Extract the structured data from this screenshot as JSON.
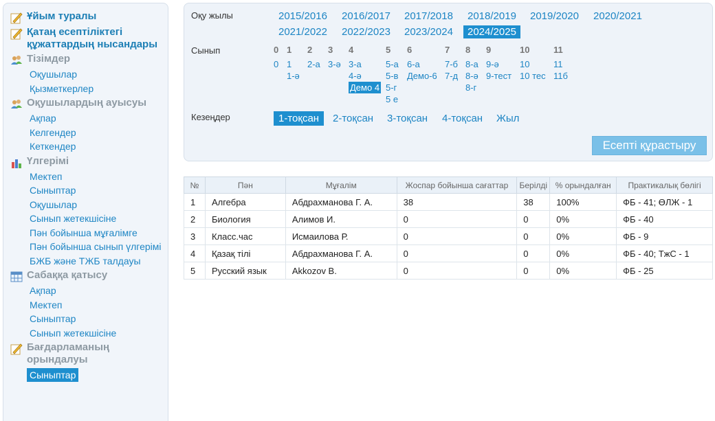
{
  "sidebar": {
    "sections": [
      {
        "title": "Ұйым туралы",
        "icon": "pencil-icon",
        "items": []
      },
      {
        "title": "Қатаң есептіліктегі құжаттардың нысандары",
        "icon": "pencil-icon",
        "items": []
      },
      {
        "title": "Тізімдер",
        "icon": "users-icon",
        "items": [
          "Оқушылар",
          "Қызметкерлер"
        ]
      },
      {
        "title": "Оқушылардың ауысуы",
        "icon": "users-icon",
        "items": [
          "Ақпар",
          "Келгендер",
          "Кеткендер"
        ]
      },
      {
        "title": "Үлгерімі",
        "icon": "bar-chart-icon",
        "items": [
          "Мектеп",
          "Сыныптар",
          "Оқушылар",
          "Сынып жетекшісіне",
          "Пән бойынша мұғалімге",
          "Пән бойынша сынып үлгерімі",
          "БЖБ және ТЖБ талдауы"
        ]
      },
      {
        "title": "Сабаққа қатысу",
        "icon": "table-icon",
        "items": [
          "Ақпар",
          "Мектеп",
          "Сыныптар",
          "Сынып жетекшісіне"
        ]
      },
      {
        "title": "Бағдарламаның орындалуы",
        "icon": "pencil-icon",
        "items": [
          "Сыныптар"
        ]
      }
    ],
    "selected_item": "Сыныптар"
  },
  "filters": {
    "year_label": "Оқу жылы",
    "years": [
      "2015/2016",
      "2016/2017",
      "2017/2018",
      "2018/2019",
      "2019/2020",
      "2020/2021",
      "2021/2022",
      "2022/2023",
      "2023/2024",
      "2024/2025"
    ],
    "selected_year": "2024/2025",
    "class_label": "Сынып",
    "grades": [
      {
        "grade": "0",
        "classes": [
          "0"
        ]
      },
      {
        "grade": "1",
        "classes": [
          "1",
          "1-ә"
        ]
      },
      {
        "grade": "2",
        "classes": [
          "2-а"
        ]
      },
      {
        "grade": "3",
        "classes": [
          "3-ә"
        ]
      },
      {
        "grade": "4",
        "classes": [
          "3-а",
          "4-ә",
          "Демо 4"
        ]
      },
      {
        "grade": "5",
        "classes": [
          "5-а",
          "5-в",
          "5-г",
          "5 е"
        ]
      },
      {
        "grade": "6",
        "classes": [
          "6-а",
          "Демо-6"
        ]
      },
      {
        "grade": "7",
        "classes": [
          "7-б",
          "7-д"
        ]
      },
      {
        "grade": "8",
        "classes": [
          "8-а",
          "8-ә",
          "8-г"
        ]
      },
      {
        "grade": "9",
        "classes": [
          "9-ә",
          "9-тест"
        ]
      },
      {
        "grade": "10",
        "classes": [
          "10",
          "10 тес"
        ]
      },
      {
        "grade": "11",
        "classes": [
          "11",
          "11б"
        ]
      }
    ],
    "selected_class": "Демо 4",
    "period_label": "Кезеңдер",
    "periods": [
      "1-тоқсан",
      "2-тоқсан",
      "3-тоқсан",
      "4-тоқсан",
      "Жыл"
    ],
    "selected_period": "1-тоқсан",
    "build_button": "Есепті құрастыру"
  },
  "table": {
    "headers": [
      "№",
      "Пән",
      "Мұғалім",
      "Жоспар бойынша сағаттар",
      "Берілді",
      "% орындалған",
      "Практикалық бөлігі"
    ],
    "rows": [
      [
        "1",
        "Алгебра",
        "Абдрахманова Г. А.",
        "38",
        "38",
        "100%",
        "ФБ - 41; ӨЛЖ - 1"
      ],
      [
        "2",
        "Биология",
        "Алимов И.",
        "0",
        "0",
        "0%",
        "ФБ - 40"
      ],
      [
        "3",
        "Класс.час",
        "Исмаилова Р.",
        "0",
        "0",
        "0%",
        "ФБ - 9"
      ],
      [
        "4",
        "Қазақ тілі",
        "Абдрахманова Г. А.",
        "0",
        "0",
        "0%",
        "ФБ - 40; ТжС - 1"
      ],
      [
        "5",
        "Русский язык",
        "Akkozov В.",
        "0",
        "0",
        "0%",
        "ФБ - 25"
      ]
    ]
  },
  "colors": {
    "accent": "#1e8fcf",
    "link": "#1d85c4",
    "button": "#7ac0e8",
    "panel": "#eef3f9"
  }
}
